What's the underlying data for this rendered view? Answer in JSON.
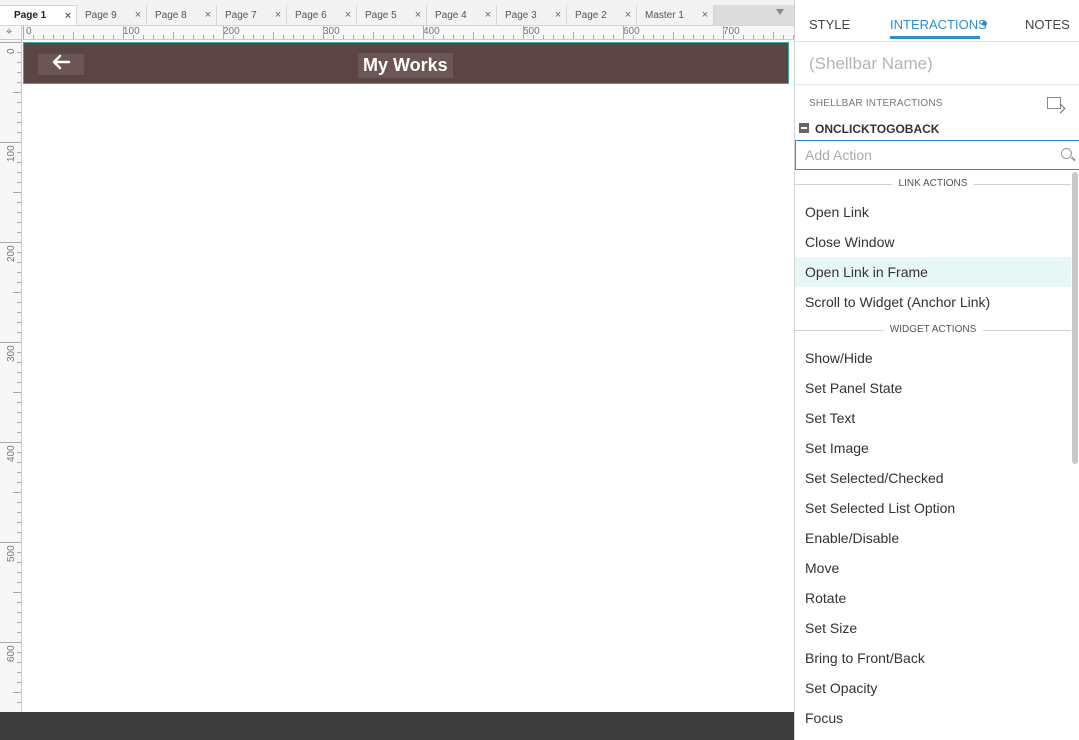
{
  "tabs": [
    {
      "label": "Page 1",
      "active": true
    },
    {
      "label": "Page 9"
    },
    {
      "label": "Page 8"
    },
    {
      "label": "Page 7"
    },
    {
      "label": "Page 6"
    },
    {
      "label": "Page 5"
    },
    {
      "label": "Page 4"
    },
    {
      "label": "Page 3"
    },
    {
      "label": "Page 2"
    },
    {
      "label": "Master 1"
    }
  ],
  "tab_close_glyph": "×",
  "ruler": {
    "corner_glyph": "⌖",
    "h_labels": [
      "0",
      "100",
      "200",
      "300",
      "400",
      "500",
      "600",
      "700"
    ],
    "v_labels": [
      "0",
      "100",
      "200",
      "300",
      "400",
      "500",
      "600"
    ]
  },
  "shellbar": {
    "back_icon": "arrow-left-icon",
    "back_glyph": "←",
    "title": "My Works",
    "color": "#5b4444",
    "border_color": "#3aa6a0"
  },
  "panel": {
    "tabs": {
      "style": "STYLE",
      "interactions": "INTERACTIONS",
      "notes": "NOTES"
    },
    "accent": "#2f8ecf",
    "name_placeholder": "(Shellbar Name)",
    "interactions_label": "SHELLBAR INTERACTIONS",
    "event_name": "ONCLICKTOGOBACK",
    "action_placeholder": "Add Action",
    "sections": [
      {
        "header": "LINK ACTIONS",
        "items": [
          "Open Link",
          "Close Window",
          "Open Link in Frame",
          "Scroll to Widget (Anchor Link)"
        ]
      },
      {
        "header": "WIDGET ACTIONS",
        "items": [
          "Show/Hide",
          "Set Panel State",
          "Set Text",
          "Set Image",
          "Set Selected/Checked",
          "Set Selected List Option",
          "Enable/Disable",
          "Move",
          "Rotate",
          "Set Size",
          "Bring to Front/Back",
          "Set Opacity",
          "Focus"
        ]
      }
    ],
    "highlighted_item": "Open Link in Frame"
  }
}
